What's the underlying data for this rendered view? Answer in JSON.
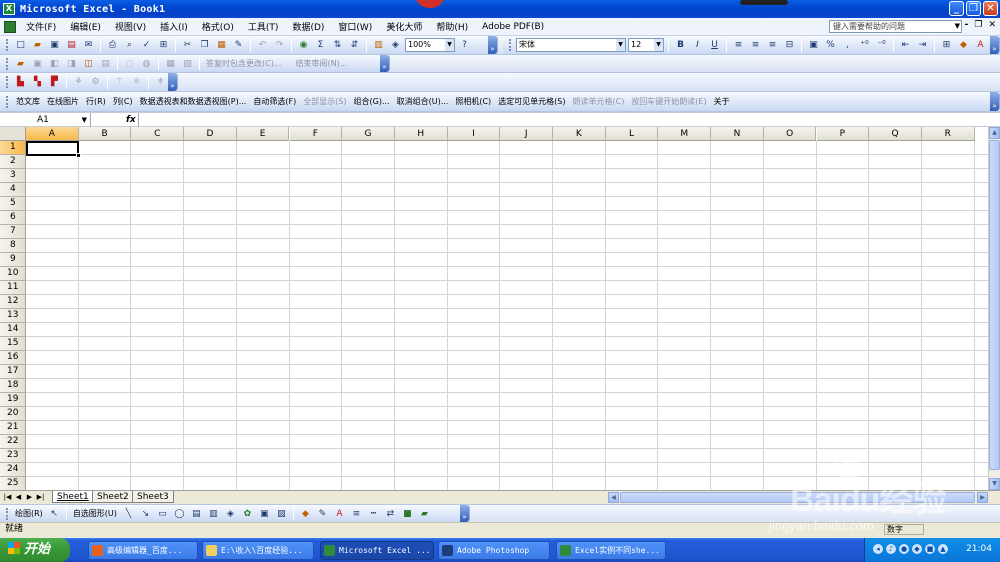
{
  "title_bar": {
    "title": "Microsoft Excel - Book1",
    "app_icon": "excel-icon"
  },
  "window_controls": {
    "minimize": "_",
    "restore": "❐",
    "close": "✕"
  },
  "menubar": {
    "items": [
      "文件(F)",
      "编辑(E)",
      "视图(V)",
      "插入(I)",
      "格式(O)",
      "工具(T)",
      "数据(D)",
      "窗口(W)",
      "美化大师",
      "帮助(H)",
      "Adobe PDF(B)"
    ],
    "help_placeholder": "键入需要帮助的问题",
    "doc_controls": [
      "-",
      "❐",
      "✕"
    ]
  },
  "standard_toolbar": {
    "zoom": "100%"
  },
  "formatting_toolbar": {
    "font": "宋体",
    "size": "12",
    "bold": "B",
    "italic": "I",
    "underline": "U",
    "percent": "%"
  },
  "review_toolbar": {
    "reply_label": "答复时包含更改(C)...",
    "end_review_label": "结束审阅(N)..."
  },
  "custom_toolbar": {
    "items": [
      {
        "label": "范文库",
        "enabled": true
      },
      {
        "label": "在线图片",
        "enabled": true
      },
      {
        "label": "行(R)",
        "enabled": true
      },
      {
        "label": "列(C)",
        "enabled": true
      },
      {
        "label": "数据透视表和数据透视图(P)...",
        "enabled": true
      },
      {
        "label": "自动筛选(F)",
        "enabled": true
      },
      {
        "label": "全部显示(S)",
        "enabled": false
      },
      {
        "label": "组合(G)...",
        "enabled": true
      },
      {
        "label": "取消组合(U)...",
        "enabled": true
      },
      {
        "label": "照相机(C)",
        "enabled": true
      },
      {
        "label": "选定可见单元格(S)",
        "enabled": true
      },
      {
        "label": "朗读单元格(C)",
        "enabled": false
      },
      {
        "label": "按回车键开始朗读(E)",
        "enabled": false
      },
      {
        "label": "关于",
        "enabled": true
      }
    ]
  },
  "formula_bar": {
    "name_box": "A1",
    "fx": "fx",
    "content": ""
  },
  "grid": {
    "columns": [
      "A",
      "B",
      "C",
      "D",
      "E",
      "F",
      "G",
      "H",
      "I",
      "J",
      "K",
      "L",
      "M",
      "N",
      "O",
      "P",
      "Q",
      "R"
    ],
    "rows": [
      "1",
      "2",
      "3",
      "4",
      "5",
      "6",
      "7",
      "8",
      "9",
      "10",
      "11",
      "12",
      "13",
      "14",
      "15",
      "16",
      "17",
      "18",
      "19",
      "20",
      "21",
      "22",
      "23",
      "24",
      "25"
    ],
    "active_cell": "A1"
  },
  "sheet_tabs": {
    "tabs": [
      "Sheet1",
      "Sheet2",
      "Sheet3"
    ],
    "active": "Sheet1"
  },
  "drawing_toolbar": {
    "draw_label": "绘图(R)",
    "autoshapes_label": "自选图形(U)"
  },
  "status_bar": {
    "status": "就绪",
    "mode": "数字"
  },
  "taskbar": {
    "start_label": "开始",
    "tasks": [
      {
        "label": "高级编辑器_百度...",
        "active": false
      },
      {
        "label": "E:\\收入\\百度经验...",
        "active": false
      },
      {
        "label": "Microsoft Excel ...",
        "active": true
      },
      {
        "label": "Adobe Photoshop",
        "active": false
      },
      {
        "label": "Excel实例不同she...",
        "active": false
      }
    ],
    "clock": "21:04"
  },
  "watermark": {
    "brand": "Baidu经验",
    "url": "jingyan.baidu.com"
  },
  "colors": {
    "title_blue": "#0A5FE6",
    "taskbar_blue": "#245EDB",
    "start_green": "#3A9A3A",
    "header_selected": "#F8B84A"
  }
}
